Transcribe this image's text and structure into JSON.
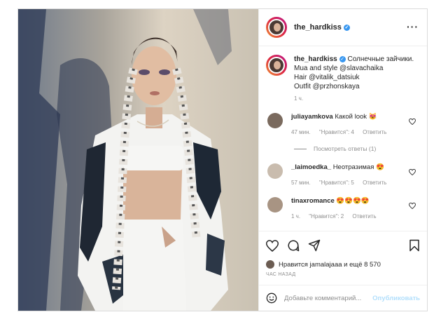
{
  "post": {
    "username": "the_hardkiss",
    "caption_text": "Солнечные зайчики.",
    "caption_line2": "Mua and style @slavachaika",
    "caption_line3": "Hair @vitalik_datsiuk",
    "caption_line4": "Outfit @przhonskaya",
    "caption_time": "1 ч.",
    "comments": [
      {
        "username": "juliayamkova",
        "text": "Какой look 😻",
        "time": "47 мин.",
        "likes": "\"Нравится\": 4",
        "reply": "Ответить"
      },
      {
        "username": "_laimoedka_",
        "text": "Неотразимая 😍",
        "time": "57 мин.",
        "likes": "\"Нравится\": 5",
        "reply": "Ответить"
      },
      {
        "username": "tinaxromance",
        "text": "😍😍😍😍",
        "time": "1 ч.",
        "likes": "\"Нравится\": 2",
        "reply": "Ответить"
      }
    ],
    "view_replies": "Посмотреть ответы (1)",
    "likes_text": "Нравится jamalajaaa и ещё 8 570",
    "date": "ЧАС НАЗАД",
    "add_comment_placeholder": "Добавьте комментарий...",
    "post_button": "Опубликовать"
  },
  "colors": {
    "accent": "#3897f0",
    "post_button": "#b2dffc",
    "muted": "#8e8e8e"
  }
}
